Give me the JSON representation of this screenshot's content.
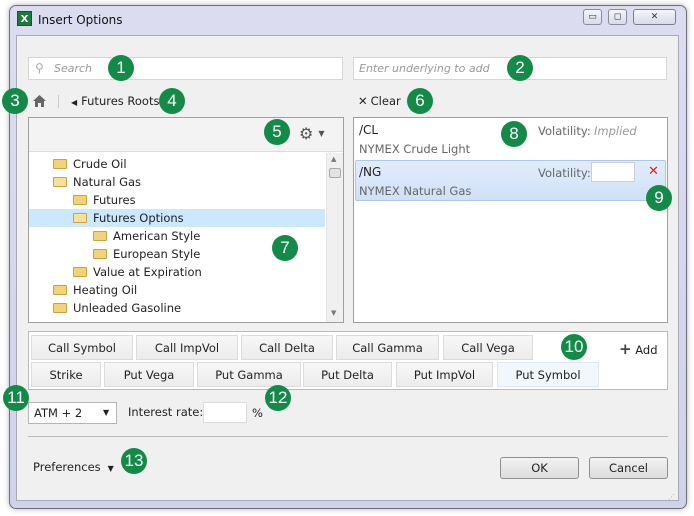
{
  "window": {
    "title": "Insert Options",
    "app_icon": "X",
    "controls": {
      "minimize": "▭",
      "restore": "◻",
      "close": "✕"
    }
  },
  "search": {
    "placeholder": "Search",
    "icon": "search-icon"
  },
  "underlying": {
    "placeholder": "Enter underlying to add"
  },
  "breadcrumb": {
    "home_icon": "home-icon",
    "back_label": "Futures Roots"
  },
  "clear_label": "Clear",
  "tree": {
    "items": [
      {
        "label": "Crude Oil",
        "level": 0,
        "open": false,
        "selected": false
      },
      {
        "label": "Natural Gas",
        "level": 0,
        "open": true,
        "selected": false
      },
      {
        "label": "Futures",
        "level": 1,
        "open": false,
        "selected": false
      },
      {
        "label": "Futures Options",
        "level": 1,
        "open": true,
        "selected": true
      },
      {
        "label": "American Style",
        "level": 2,
        "open": false,
        "selected": false
      },
      {
        "label": "European Style",
        "level": 2,
        "open": false,
        "selected": false
      },
      {
        "label": "Value at Expiration",
        "level": 1,
        "open": false,
        "selected": false
      },
      {
        "label": "Heating Oil",
        "level": 0,
        "open": false,
        "selected": false
      },
      {
        "label": "Unleaded Gasoline",
        "level": 0,
        "open": false,
        "selected": false
      }
    ]
  },
  "underlyings": [
    {
      "symbol": "/CL",
      "name": "NYMEX Crude Light",
      "vol_label": "Volatility:",
      "vol_value": "Implied"
    },
    {
      "symbol": "/NG",
      "name": "NYMEX Natural Gas",
      "vol_label": "Volatility:",
      "vol_value": ""
    }
  ],
  "columns": {
    "row1": [
      "Call Symbol",
      "Call ImpVol",
      "Call Delta",
      "Call Gamma",
      "Call Vega"
    ],
    "row2": [
      "Strike",
      "Put Vega",
      "Put Gamma",
      "Put Delta",
      "Put ImpVol",
      "Put Symbol"
    ],
    "add_label": "Add"
  },
  "strikes": {
    "selected": "ATM + 2"
  },
  "interest": {
    "label": "Interest rate:",
    "value": "",
    "unit": "%"
  },
  "preferences_label": "Preferences",
  "ok_label": "OK",
  "cancel_label": "Cancel",
  "badges": [
    "1",
    "2",
    "3",
    "4",
    "5",
    "6",
    "7",
    "8",
    "9",
    "10",
    "11",
    "12",
    "13"
  ],
  "colors": {
    "badge": "#138a48",
    "selection": "#cce8ff",
    "remove": "#e02020"
  }
}
